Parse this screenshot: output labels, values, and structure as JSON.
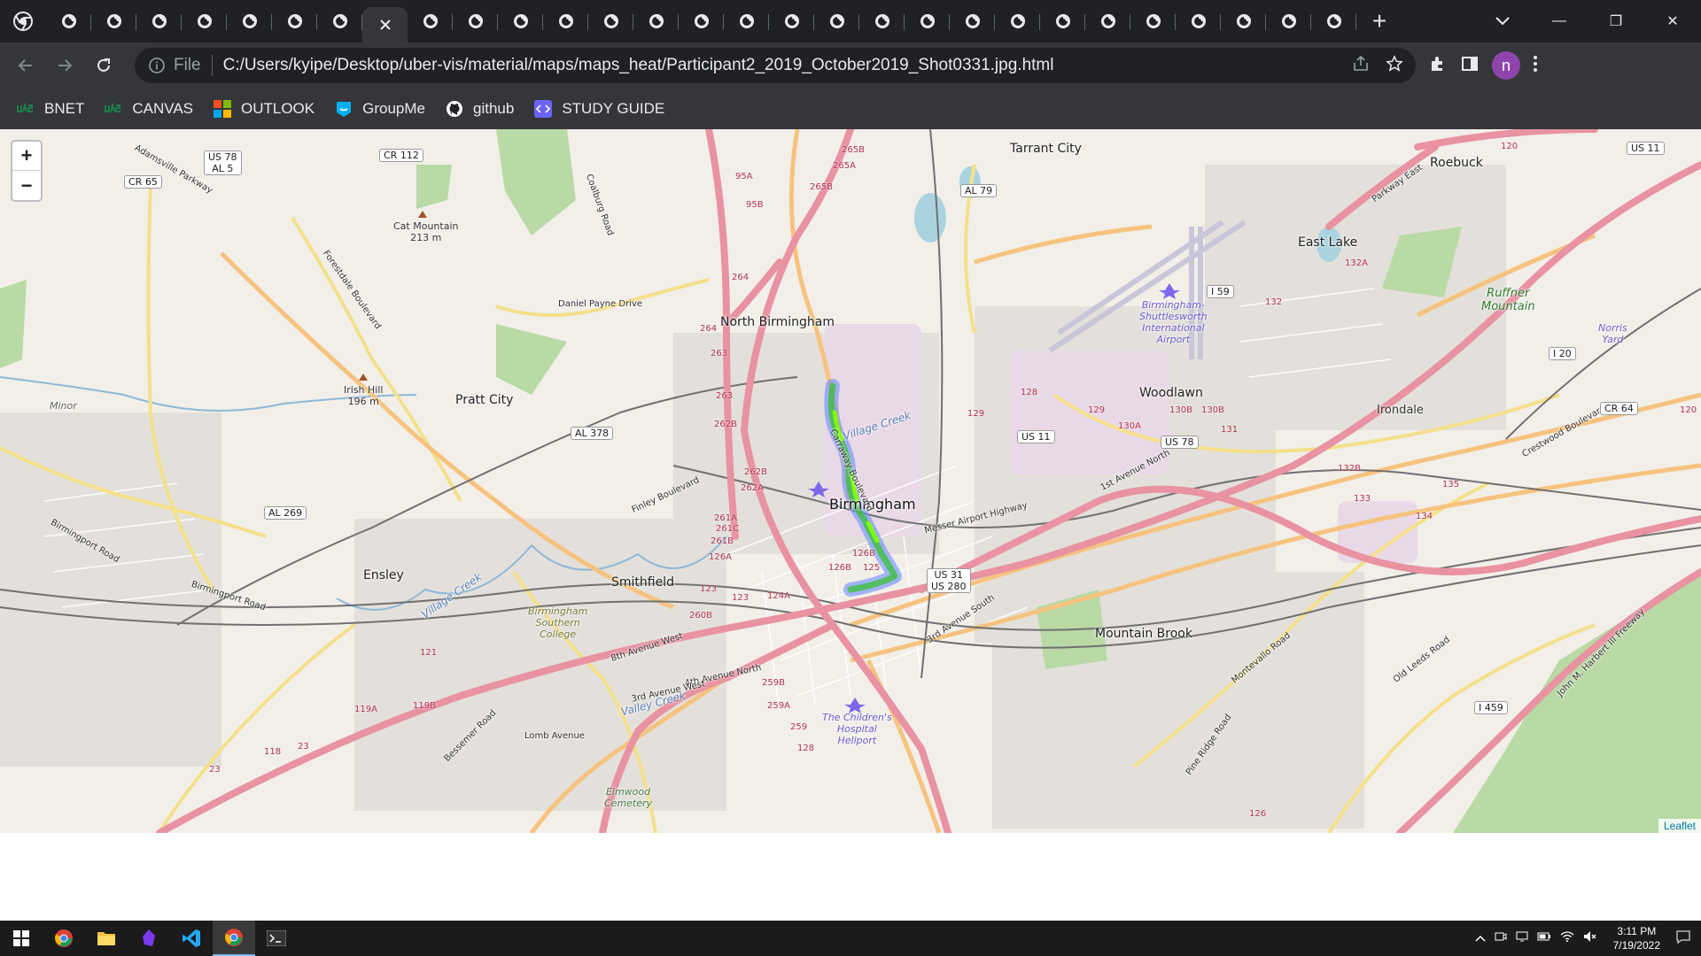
{
  "browser": {
    "tab_count": 29,
    "active_tab_index": 7,
    "new_tab_label": "+",
    "window_controls": {
      "minimize": "—",
      "restore": "❐",
      "close": "✕"
    },
    "omnibox": {
      "scheme_label": "File",
      "url": "C:/Users/kyipe/Desktop/uber-vis/material/maps/maps_heat/Participant2_2019_October2019_Shot0331.jpg.html"
    },
    "profile_initial": "n"
  },
  "bookmarks": [
    {
      "label": "BNET",
      "icon": "uab-icon",
      "color": "#1a7f4b"
    },
    {
      "label": "CANVAS",
      "icon": "uab-icon",
      "color": "#1a7f4b"
    },
    {
      "label": "OUTLOOK",
      "icon": "microsoft-icon",
      "color": "#f25022"
    },
    {
      "label": "GroupMe",
      "icon": "groupme-icon",
      "color": "#00aff0"
    },
    {
      "label": "github",
      "icon": "github-icon",
      "color": "#ffffff"
    },
    {
      "label": "STUDY GUIDE",
      "icon": "code-icon",
      "color": "#6c63ff"
    }
  ],
  "map": {
    "zoom_in": "+",
    "zoom_out": "−",
    "attribution": "Leaflet",
    "places": {
      "tarrant_city": "Tarrant City",
      "roebuck": "Roebuck",
      "east_lake": "East Lake",
      "ruffner_mountain": "Ruffner\nMountain",
      "norris_yard": "Norris\nYard",
      "north_birmingham": "North Birmingham",
      "pratt_city": "Pratt City",
      "woodlawn": "Woodlawn",
      "irondale": "Irondale",
      "birmingham": "Birmingham",
      "ensley": "Ensley",
      "smithfield": "Smithfield",
      "mountain_brook": "Mountain Brook",
      "minor": "Minor",
      "cat_mountain": "Cat Mountain\n213 m",
      "irish_hill": "Irish Hill\n196 m",
      "airport": "Birmingham-\nShuttlesworth\nInternational\nAirport",
      "bsc": "Birmingham\nSouthern\nCollege",
      "childrens": "The Children's\nHospital\nHeliport",
      "elmwood": "Elmwood\nCemetery",
      "village_creek": "Village Creek",
      "village_creek_2": "Village Creek",
      "valley_creek": "Valley Creek",
      "daniel_payne": "Daniel Payne Drive",
      "finley": "Finley Boulevard",
      "messer": "Messer Airport Highway",
      "first_ave_n": "1st Avenue North",
      "crestwood": "Crestwood Boulevard",
      "montevallo": "Montevallo Road",
      "old_leeds": "Old Leeds Road",
      "lomb": "Lomb Avenue",
      "bessemer": "Bessemer Road",
      "eighth_ave_w": "8th Avenue West",
      "fourth_ave_n": "4th Avenue North",
      "third_ave_w": "3rd Avenue West",
      "third_ave_s": "3rd Avenue South",
      "birmingport": "Birmingport Road",
      "birmingport_2": "Birmingport Road",
      "forestdale": "Forestdale Boulevard",
      "adamsville": "Adamsville Parkway",
      "carraway": "Carraway Boulevard",
      "cosby": "Coalburg Road",
      "parkway": "Parkway East",
      "pine_ridge": "Pine Ridge Road",
      "john_rogers": "John M. Harbert III Freeway"
    },
    "shields": {
      "us78_al5": "US 78\nAL 5",
      "cr65": "CR 65",
      "cr112": "CR 112",
      "al79": "AL 79",
      "us11_ne": "US 11",
      "i59": "I 59",
      "i20": "I 20",
      "cr64": "CR 64",
      "al378": "AL 378",
      "us11": "US 11",
      "us78": "US 78",
      "al269": "AL 269",
      "us31_280": "US 31\nUS 280",
      "i459": "I 459"
    },
    "exits": [
      "265B",
      "265A",
      "95A",
      "95B",
      "265B",
      "264",
      "264",
      "263",
      "263",
      "262B",
      "262B",
      "262A",
      "261A",
      "261C",
      "261B",
      "126A",
      "126B",
      "126B",
      "125",
      "124A",
      "123",
      "123",
      "260B",
      "259B",
      "259A",
      "259",
      "128",
      "128",
      "129",
      "129",
      "130A",
      "130B",
      "130B",
      "131",
      "132",
      "132A",
      "132B",
      "133",
      "134",
      "135",
      "120",
      "120",
      "121",
      "119A",
      "119B",
      "118",
      "23",
      "23",
      "126"
    ],
    "heat_colors": {
      "core": "#7fff00",
      "mid": "#3fbf3f",
      "edge": "#3355ff"
    }
  },
  "taskbar": {
    "apps": [
      "windows-start-icon",
      "chrome-icon",
      "file-explorer-icon",
      "obsidian-icon",
      "vscode-icon",
      "chrome-icon",
      "terminal-icon"
    ],
    "active_index": 5,
    "time": "3:11 PM",
    "date": "7/19/2022"
  }
}
